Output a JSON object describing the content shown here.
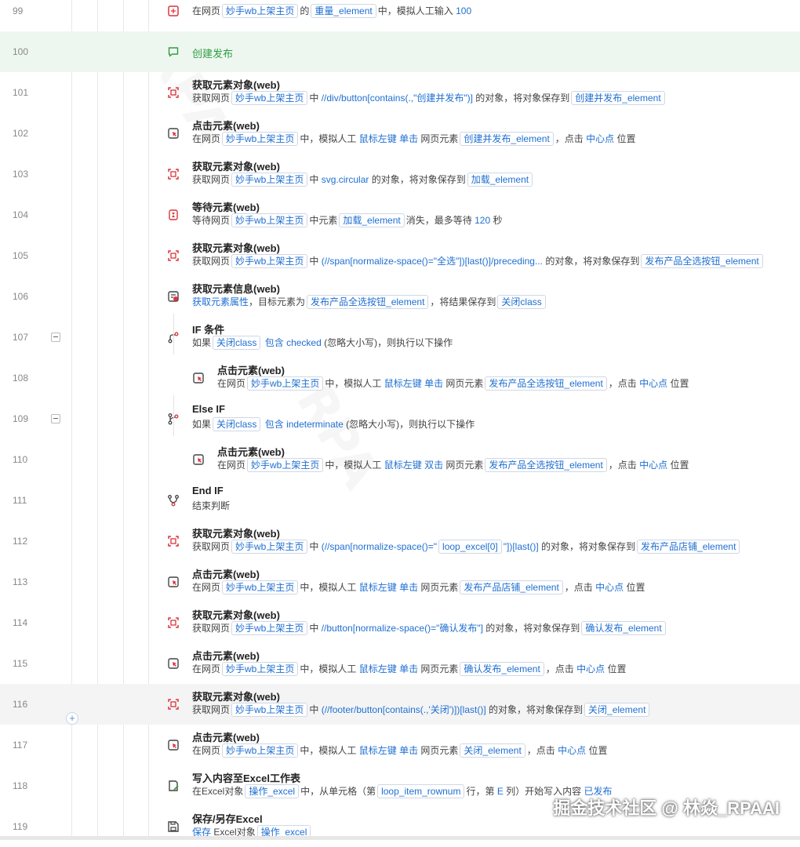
{
  "rows": [
    {
      "ln": "99",
      "icon": "enter",
      "desc": [
        {
          "t": "在网页"
        },
        {
          "tag": "妙手wb上架主页"
        },
        {
          "t": "的"
        },
        {
          "tag": "重量_element"
        },
        {
          "t": "中，模拟人工输入 "
        },
        {
          "kw": "100"
        }
      ]
    },
    {
      "ln": "100",
      "icon": "comment",
      "title": "创建发布",
      "green": true
    },
    {
      "ln": "101",
      "icon": "get",
      "title": "获取元素对象(web)",
      "desc": [
        {
          "t": "获取网页"
        },
        {
          "tag": "妙手wb上架主页"
        },
        {
          "t": "中 "
        },
        {
          "kw": "//div/button[contains(.,\"创建并发布\")]"
        },
        {
          "t": " 的对象，将对象保存到"
        },
        {
          "tag": "创建并发布_element"
        }
      ]
    },
    {
      "ln": "102",
      "icon": "click",
      "title": "点击元素(web)",
      "desc": [
        {
          "t": "在网页"
        },
        {
          "tag": "妙手wb上架主页"
        },
        {
          "t": "中，模拟人工 "
        },
        {
          "kw": "鼠标左键"
        },
        {
          "t": " "
        },
        {
          "kw": "单击"
        },
        {
          "t": " 网页元素"
        },
        {
          "tag": "创建并发布_element"
        },
        {
          "t": "，点击 "
        },
        {
          "kw": "中心点"
        },
        {
          "t": " 位置"
        }
      ]
    },
    {
      "ln": "103",
      "icon": "get",
      "title": "获取元素对象(web)",
      "desc": [
        {
          "t": "获取网页"
        },
        {
          "tag": "妙手wb上架主页"
        },
        {
          "t": "中 "
        },
        {
          "kw": "svg.circular"
        },
        {
          "t": " 的对象，将对象保存到"
        },
        {
          "tag": "加载_element"
        }
      ]
    },
    {
      "ln": "104",
      "icon": "wait",
      "title": "等待元素(web)",
      "desc": [
        {
          "t": "等待网页"
        },
        {
          "tag": "妙手wb上架主页"
        },
        {
          "t": "中元素"
        },
        {
          "tag": "加载_element"
        },
        {
          "t": "消失，最多等待 "
        },
        {
          "kw": "120"
        },
        {
          "t": " 秒"
        }
      ]
    },
    {
      "ln": "105",
      "icon": "get",
      "title": "获取元素对象(web)",
      "desc": [
        {
          "t": "获取网页"
        },
        {
          "tag": "妙手wb上架主页"
        },
        {
          "t": "中 "
        },
        {
          "kw": "(//span[normalize-space()=\"全选\"])[last()]/preceding..."
        },
        {
          "t": " 的对象，将对象保存到"
        },
        {
          "tag": "发布产品全选按钮_element"
        }
      ]
    },
    {
      "ln": "106",
      "icon": "info",
      "title": "获取元素信息(web)",
      "desc": [
        {
          "kw": "获取元素属性"
        },
        {
          "t": "，目标元素为"
        },
        {
          "tag": "发布产品全选按钮_element"
        },
        {
          "t": "，将结果保存到"
        },
        {
          "tag": "关闭class"
        }
      ]
    },
    {
      "ln": "107",
      "icon": "if",
      "title": "IF 条件",
      "collapse": true,
      "desc": [
        {
          "t": "如果"
        },
        {
          "tag": "关闭class"
        },
        {
          "t": " "
        },
        {
          "kw": "包含"
        },
        {
          "t": " "
        },
        {
          "kw": "checked"
        },
        {
          "t": " (忽略大小写)，则执行以下操作"
        }
      ]
    },
    {
      "ln": "108",
      "icon": "click",
      "title": "点击元素(web)",
      "indent": true,
      "desc": [
        {
          "t": "在网页"
        },
        {
          "tag": "妙手wb上架主页"
        },
        {
          "t": "中，模拟人工 "
        },
        {
          "kw": "鼠标左键"
        },
        {
          "t": " "
        },
        {
          "kw": "单击"
        },
        {
          "t": " 网页元素"
        },
        {
          "tag": "发布产品全选按钮_element"
        },
        {
          "t": "，点击 "
        },
        {
          "kw": "中心点"
        },
        {
          "t": " 位置"
        }
      ]
    },
    {
      "ln": "109",
      "icon": "elseif",
      "title": "Else IF",
      "collapse": true,
      "desc": [
        {
          "t": "如果"
        },
        {
          "tag": "关闭class"
        },
        {
          "t": " "
        },
        {
          "kw": "包含"
        },
        {
          "t": " "
        },
        {
          "kw": "indeterminate"
        },
        {
          "t": " (忽略大小写)，则执行以下操作"
        }
      ]
    },
    {
      "ln": "110",
      "icon": "click",
      "title": "点击元素(web)",
      "indent": true,
      "desc": [
        {
          "t": "在网页"
        },
        {
          "tag": "妙手wb上架主页"
        },
        {
          "t": "中，模拟人工 "
        },
        {
          "kw": "鼠标左键"
        },
        {
          "t": " "
        },
        {
          "kw": "双击"
        },
        {
          "t": " 网页元素"
        },
        {
          "tag": "发布产品全选按钮_element"
        },
        {
          "t": "，点击 "
        },
        {
          "kw": "中心点"
        },
        {
          "t": " 位置"
        }
      ]
    },
    {
      "ln": "111",
      "icon": "endif",
      "title": "End IF",
      "desc": [
        {
          "t": "结束判断"
        }
      ]
    },
    {
      "ln": "112",
      "icon": "get",
      "title": "获取元素对象(web)",
      "desc": [
        {
          "t": "获取网页"
        },
        {
          "tag": "妙手wb上架主页"
        },
        {
          "t": "中 "
        },
        {
          "kw": "(//span[normalize-space()=\""
        },
        {
          "tag": "loop_excel[0]"
        },
        {
          "kw": "\"])[last()]"
        },
        {
          "t": " 的对象，将对象保存到"
        },
        {
          "tag": "发布产品店铺_element"
        }
      ]
    },
    {
      "ln": "113",
      "icon": "click",
      "title": "点击元素(web)",
      "desc": [
        {
          "t": "在网页"
        },
        {
          "tag": "妙手wb上架主页"
        },
        {
          "t": "中，模拟人工 "
        },
        {
          "kw": "鼠标左键"
        },
        {
          "t": " "
        },
        {
          "kw": "单击"
        },
        {
          "t": " 网页元素"
        },
        {
          "tag": "发布产品店铺_element"
        },
        {
          "t": "，点击 "
        },
        {
          "kw": "中心点"
        },
        {
          "t": " 位置"
        }
      ]
    },
    {
      "ln": "114",
      "icon": "get",
      "title": "获取元素对象(web)",
      "desc": [
        {
          "t": "获取网页"
        },
        {
          "tag": "妙手wb上架主页"
        },
        {
          "t": "中 "
        },
        {
          "kw": "//button[normalize-space()=\"确认发布\"]"
        },
        {
          "t": " 的对象，将对象保存到"
        },
        {
          "tag": "确认发布_element"
        }
      ]
    },
    {
      "ln": "115",
      "icon": "click",
      "title": "点击元素(web)",
      "desc": [
        {
          "t": "在网页"
        },
        {
          "tag": "妙手wb上架主页"
        },
        {
          "t": "中，模拟人工 "
        },
        {
          "kw": "鼠标左键"
        },
        {
          "t": " "
        },
        {
          "kw": "单击"
        },
        {
          "t": " 网页元素"
        },
        {
          "tag": "确认发布_element"
        },
        {
          "t": "，点击 "
        },
        {
          "kw": "中心点"
        },
        {
          "t": " 位置"
        }
      ]
    },
    {
      "ln": "116",
      "icon": "get",
      "title": "获取元素对象(web)",
      "highlight": "gray",
      "desc": [
        {
          "t": "获取网页"
        },
        {
          "tag": "妙手wb上架主页"
        },
        {
          "t": "中 "
        },
        {
          "kw": "(//footer/button[contains(.,'关闭')])[last()]"
        },
        {
          "t": " 的对象，将对象保存到"
        },
        {
          "tag": "关闭_element"
        }
      ]
    },
    {
      "ln": "117",
      "icon": "click",
      "title": "点击元素(web)",
      "desc": [
        {
          "t": "在网页"
        },
        {
          "tag": "妙手wb上架主页"
        },
        {
          "t": "中，模拟人工 "
        },
        {
          "kw": "鼠标左键"
        },
        {
          "t": " "
        },
        {
          "kw": "单击"
        },
        {
          "t": " 网页元素"
        },
        {
          "tag": "关闭_element"
        },
        {
          "t": "，点击 "
        },
        {
          "kw": "中心点"
        },
        {
          "t": " 位置"
        }
      ]
    },
    {
      "ln": "118",
      "icon": "excel",
      "title": "写入内容至Excel工作表",
      "desc": [
        {
          "t": "在Excel对象"
        },
        {
          "tag": "操作_excel"
        },
        {
          "t": "中，从单元格（第"
        },
        {
          "tag": "loop_item_rownum"
        },
        {
          "t": "行，第 "
        },
        {
          "kw": "E"
        },
        {
          "t": " 列）开始写入内容 "
        },
        {
          "kw": "已发布"
        }
      ]
    },
    {
      "ln": "119",
      "icon": "save",
      "title": "保存/另存Excel",
      "desc": [
        {
          "kw": "保存"
        },
        {
          "t": " Excel对象"
        },
        {
          "tag": "操作_excel"
        }
      ]
    }
  ],
  "watermark": "RPA",
  "credit": "掘金技术社区 @ 林焱_RPAAI",
  "colors": {
    "accent": "#1f6fd1",
    "green": "#2f9e44",
    "icon_red": "#d9363e"
  }
}
